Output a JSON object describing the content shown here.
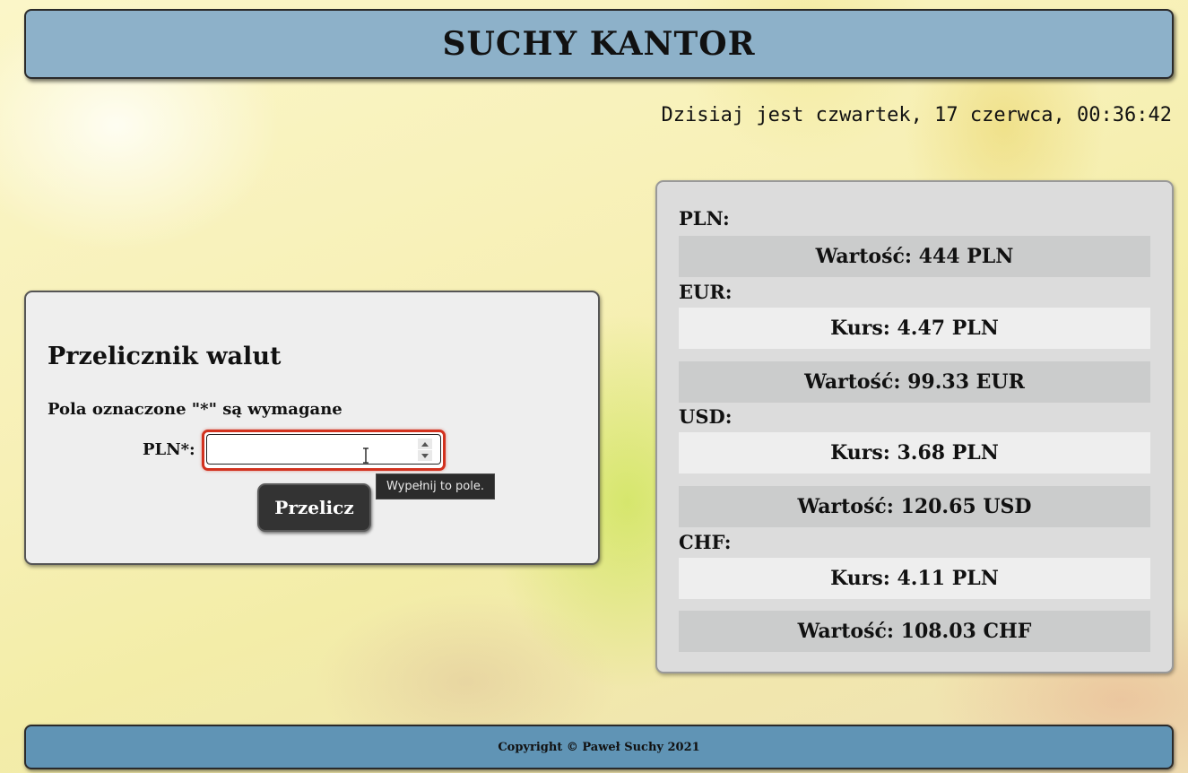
{
  "header": {
    "title": "SUCHY KANTOR"
  },
  "clock": {
    "text": "Dzisiaj jest czwartek, 17 czerwca, 00:36:42"
  },
  "converter": {
    "title": "Przelicznik walut",
    "required_note": "Pola oznaczone \"*\" są wymagane",
    "input_label": "PLN*:",
    "input_value": "",
    "validation_tooltip": "Wypełnij to pole.",
    "button_label": "Przelicz"
  },
  "results": {
    "pln": {
      "label": "PLN:",
      "value": "Wartość: 444 PLN"
    },
    "eur": {
      "label": "EUR:",
      "rate": "Kurs: 4.47 PLN",
      "value": "Wartość: 99.33 EUR"
    },
    "usd": {
      "label": "USD:",
      "rate": "Kurs: 3.68 PLN",
      "value": "Wartość: 120.65 USD"
    },
    "chf": {
      "label": "CHF:",
      "rate": "Kurs: 4.11 PLN",
      "value": "Wartość: 108.03 CHF"
    }
  },
  "footer": {
    "text": "Copyright © Paweł Suchy 2021"
  },
  "colors": {
    "header_bg": "#8db1c9",
    "footer_bg": "#6094b5",
    "button_bg": "#333333",
    "input_error_border": "#d2321f"
  }
}
